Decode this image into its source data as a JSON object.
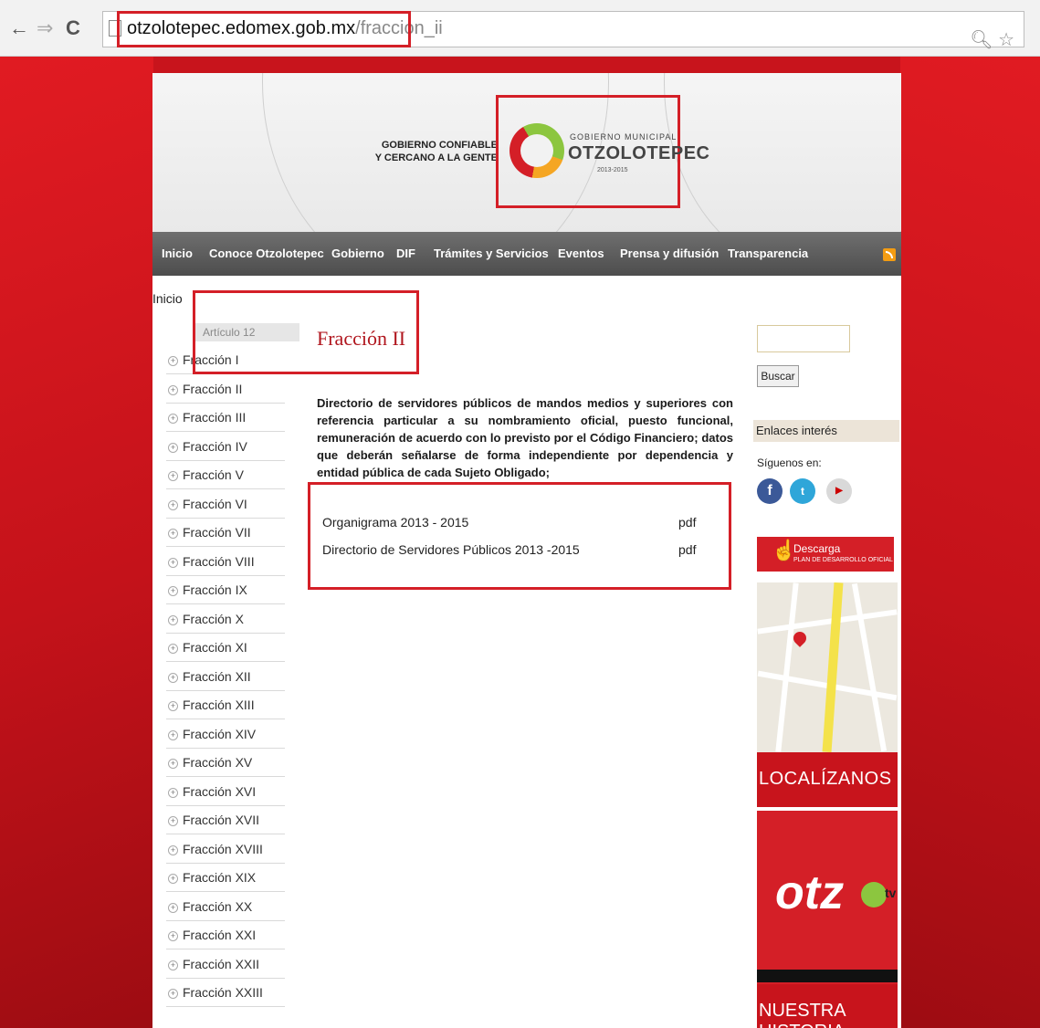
{
  "browser": {
    "back": "←",
    "forward": "⇒",
    "reload": "C",
    "url_domain": "otzolotepec.edomex.gob.mx",
    "url_path": "/fraccion_ii",
    "zoom_icon": "🔍︎",
    "star_icon": "☆"
  },
  "header": {
    "slogan_line1": "GOBIERNO CONFIABLE",
    "slogan_line2": "Y CERCANO A LA GENTE",
    "logo_top": "GOBIERNO MUNICIPAL",
    "logo_name": "OTZOLOTEPEC",
    "logo_years": "2013-2015"
  },
  "menu": [
    "Inicio",
    "Conoce Otzolotepec",
    "Gobierno",
    "DIF",
    "Trámites y Servicios",
    "Eventos",
    "Prensa y difusión",
    "Transparencia"
  ],
  "breadcrumb": "Inicio",
  "sidebar": {
    "heading": "Artículo 12",
    "items": [
      "Fracción I",
      "Fracción II",
      "Fracción III",
      "Fracción IV",
      "Fracción V",
      "Fracción VI",
      "Fracción VII",
      "Fracción VIII",
      "Fracción IX",
      "Fracción X",
      "Fracción XI",
      "Fracción XII",
      "Fracción XIII",
      "Fracción XIV",
      "Fracción XV",
      "Fracción XVI",
      "Fracción XVII",
      "Fracción XVIII",
      "Fracción XIX",
      "Fracción XX",
      "Fracción XXI",
      "Fracción XXII",
      "Fracción XXIII"
    ]
  },
  "main": {
    "title": "Fracción II",
    "description": "Directorio de servidores públicos de mandos medios y superiores con referencia particular a su nombramiento oficial, puesto funcional, remuneración de acuerdo con lo previsto por el Código Financiero; datos que deberán señalarse de forma independiente por dependencia y entidad pública de cada Sujeto Obligado;",
    "documents": [
      {
        "name": "Organigrama  2013 - 2015",
        "format": "pdf"
      },
      {
        "name": "Directorio de Servidores Públicos 2013 -2015",
        "format": "pdf"
      }
    ]
  },
  "right": {
    "search_button": "Buscar",
    "enlaces": "Enlaces interés",
    "siguenos": "Síguenos en:",
    "descarga_line1": "Descarga",
    "descarga_line2": "PLAN DE DESARROLLO OFICIAL",
    "localizanos": "LOCALÍZANOS",
    "otzo_logo": "otz",
    "tv": "tv",
    "historia": "NUESTRA HISTORIA"
  },
  "colors": {
    "brand_red": "#d41f27",
    "menu_gray": "#5a5a5a"
  }
}
